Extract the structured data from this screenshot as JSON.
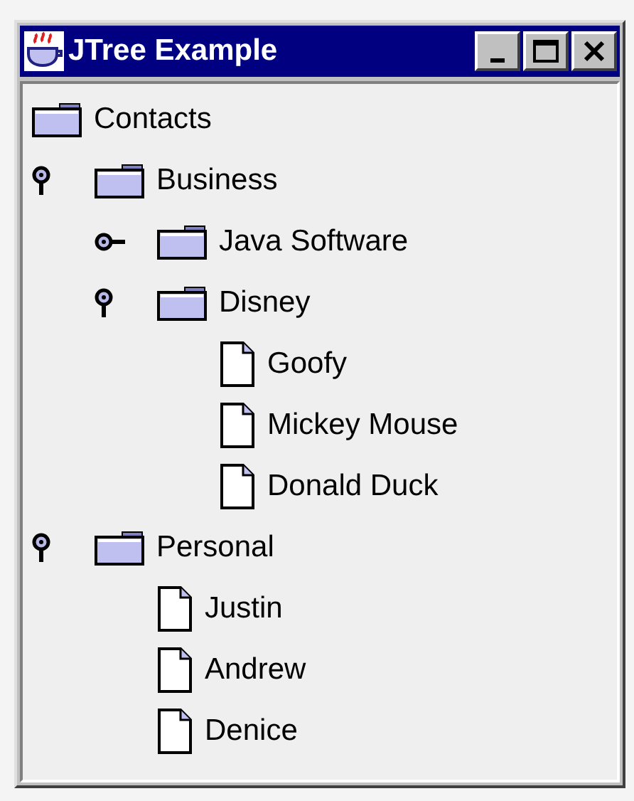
{
  "window": {
    "title": "JTree Example"
  },
  "tree": {
    "label": "Contacts",
    "kind": "folder",
    "children": [
      {
        "label": "Business",
        "kind": "folder",
        "expanded": true,
        "children": [
          {
            "label": "Java Software",
            "kind": "folder",
            "expanded": false
          },
          {
            "label": "Disney",
            "kind": "folder",
            "expanded": true,
            "children": [
              {
                "label": "Goofy",
                "kind": "leaf"
              },
              {
                "label": "Mickey Mouse",
                "kind": "leaf"
              },
              {
                "label": "Donald Duck",
                "kind": "leaf"
              }
            ]
          }
        ]
      },
      {
        "label": "Personal",
        "kind": "folder",
        "expanded": true,
        "children": [
          {
            "label": "Justin",
            "kind": "leaf"
          },
          {
            "label": "Andrew",
            "kind": "leaf"
          },
          {
            "label": "Denice",
            "kind": "leaf"
          }
        ]
      }
    ]
  }
}
